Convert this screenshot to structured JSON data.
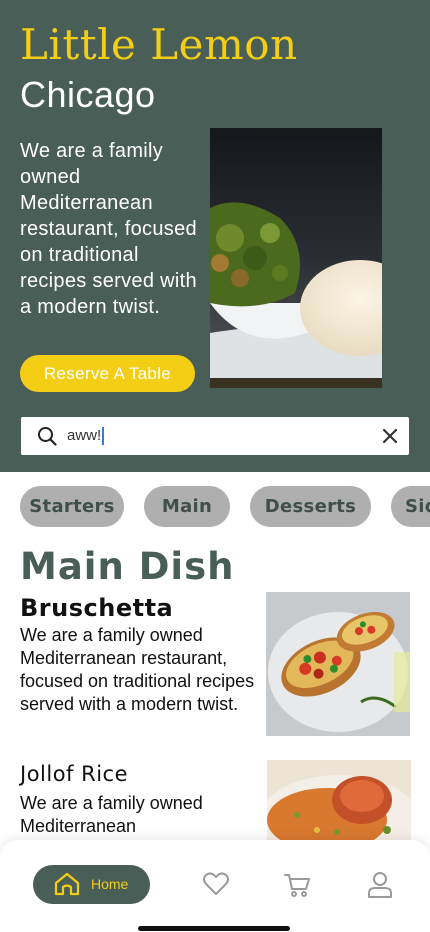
{
  "hero": {
    "brand": "Little Lemon",
    "city": "Chicago",
    "description": "We are a family owned Mediterranean restaurant, focused on traditional recipes served with a modern twist.",
    "reserve_button": "Reserve A Table",
    "photo_icon": "hero-dish-photo"
  },
  "search": {
    "value": "aww!",
    "search_icon": "search-icon",
    "clear_icon": "close-icon"
  },
  "categories": [
    {
      "label": "Starters"
    },
    {
      "label": "Main"
    },
    {
      "label": "Desserts"
    },
    {
      "label": "Sides"
    }
  ],
  "section": {
    "title": "Main Dish"
  },
  "dishes": [
    {
      "name": "Bruschetta",
      "description": "We are a family owned Mediterranean restaurant, focused on traditional recipes served with a modern twist."
    },
    {
      "name": "Jollof Rice",
      "description": "We are a family owned Mediterranean"
    }
  ],
  "nav": {
    "home_label": "Home",
    "items": [
      "home-icon",
      "heart-icon",
      "cart-icon",
      "profile-icon"
    ]
  },
  "colors": {
    "primary_green": "#495e57",
    "primary_yellow": "#f4ce14",
    "chip_gray": "#afafaf"
  }
}
